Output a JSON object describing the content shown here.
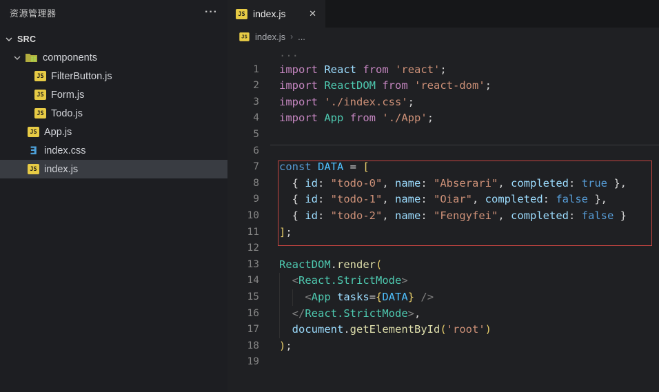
{
  "colors": {
    "accent_red_box": "#c64540",
    "js_icon_yellow": "#e7cb45",
    "css_icon_blue": "#4da0d8",
    "keyword": "#C586C0",
    "string": "#CE9178",
    "type": "#4EC9B0",
    "constant": "#4FC1FF"
  },
  "explorer": {
    "title": "资源管理器",
    "more_actions": "···",
    "section": "SRC",
    "tree": [
      {
        "label": "components",
        "icon": "folder",
        "indent": "folder-root",
        "expanded": true,
        "selected": false
      },
      {
        "label": "FilterButton.js",
        "icon": "js",
        "indent": "child",
        "expanded": null,
        "selected": false
      },
      {
        "label": "Form.js",
        "icon": "js",
        "indent": "child",
        "expanded": null,
        "selected": false
      },
      {
        "label": "Todo.js",
        "icon": "js",
        "indent": "child",
        "expanded": null,
        "selected": false
      },
      {
        "label": "App.js",
        "icon": "js",
        "indent": "root",
        "expanded": null,
        "selected": false
      },
      {
        "label": "index.css",
        "icon": "css",
        "indent": "root",
        "expanded": null,
        "selected": false
      },
      {
        "label": "index.js",
        "icon": "js",
        "indent": "root",
        "expanded": null,
        "selected": true
      }
    ]
  },
  "tab": {
    "label": "index.js",
    "close_glyph": "✕"
  },
  "breadcrumb": {
    "file": "index.js",
    "separator": "›",
    "tail": "..."
  },
  "editor": {
    "fold_hint": "...",
    "css_glyph": "Ǝ",
    "js_glyph": "JS",
    "lines": [
      {
        "num": 1,
        "guides": [],
        "tokens": [
          [
            "import",
            "kw"
          ],
          [
            " ",
            "pl"
          ],
          [
            "React",
            "var"
          ],
          [
            " ",
            "pl"
          ],
          [
            "from",
            "kw"
          ],
          [
            " ",
            "pl"
          ],
          [
            "'react'",
            "str"
          ],
          [
            ";",
            "pl"
          ]
        ]
      },
      {
        "num": 2,
        "guides": [],
        "tokens": [
          [
            "import",
            "kw"
          ],
          [
            " ",
            "pl"
          ],
          [
            "ReactDOM",
            "type"
          ],
          [
            " ",
            "pl"
          ],
          [
            "from",
            "kw"
          ],
          [
            " ",
            "pl"
          ],
          [
            "'react-dom'",
            "str"
          ],
          [
            ";",
            "pl"
          ]
        ]
      },
      {
        "num": 3,
        "guides": [],
        "tokens": [
          [
            "import",
            "kw"
          ],
          [
            " ",
            "pl"
          ],
          [
            "'./index.css'",
            "str"
          ],
          [
            ";",
            "pl"
          ]
        ]
      },
      {
        "num": 4,
        "guides": [],
        "tokens": [
          [
            "import",
            "kw"
          ],
          [
            " ",
            "pl"
          ],
          [
            "App",
            "type"
          ],
          [
            " ",
            "pl"
          ],
          [
            "from",
            "kw"
          ],
          [
            " ",
            "pl"
          ],
          [
            "'./App'",
            "str"
          ],
          [
            ";",
            "pl"
          ]
        ]
      },
      {
        "num": 5,
        "guides": [],
        "tokens": []
      },
      {
        "num": 6,
        "guides": [],
        "tokens": []
      },
      {
        "num": 7,
        "guides": [],
        "tokens": [
          [
            "const",
            "blue"
          ],
          [
            " ",
            "pl"
          ],
          [
            "DATA",
            "cvar"
          ],
          [
            " = ",
            "pl"
          ],
          [
            "[",
            "b1"
          ]
        ]
      },
      {
        "num": 8,
        "guides": [],
        "tokens": [
          [
            "  { ",
            "pl"
          ],
          [
            "id",
            "var"
          ],
          [
            ": ",
            "pl"
          ],
          [
            "\"todo-0\"",
            "str"
          ],
          [
            ", ",
            "pl"
          ],
          [
            "name",
            "var"
          ],
          [
            ": ",
            "pl"
          ],
          [
            "\"Abserari\"",
            "str"
          ],
          [
            ", ",
            "pl"
          ],
          [
            "completed",
            "var"
          ],
          [
            ": ",
            "pl"
          ],
          [
            "true",
            "blue"
          ],
          [
            " },",
            "pl"
          ]
        ]
      },
      {
        "num": 9,
        "guides": [],
        "tokens": [
          [
            "  { ",
            "pl"
          ],
          [
            "id",
            "var"
          ],
          [
            ": ",
            "pl"
          ],
          [
            "\"todo-1\"",
            "str"
          ],
          [
            ", ",
            "pl"
          ],
          [
            "name",
            "var"
          ],
          [
            ": ",
            "pl"
          ],
          [
            "\"Oiar\"",
            "str"
          ],
          [
            ", ",
            "pl"
          ],
          [
            "completed",
            "var"
          ],
          [
            ": ",
            "pl"
          ],
          [
            "false",
            "blue"
          ],
          [
            " },",
            "pl"
          ]
        ]
      },
      {
        "num": 10,
        "guides": [],
        "tokens": [
          [
            "  { ",
            "pl"
          ],
          [
            "id",
            "var"
          ],
          [
            ": ",
            "pl"
          ],
          [
            "\"todo-2\"",
            "str"
          ],
          [
            ", ",
            "pl"
          ],
          [
            "name",
            "var"
          ],
          [
            ": ",
            "pl"
          ],
          [
            "\"Fengyfei\"",
            "str"
          ],
          [
            ", ",
            "pl"
          ],
          [
            "completed",
            "var"
          ],
          [
            ": ",
            "pl"
          ],
          [
            "false",
            "blue"
          ],
          [
            " }",
            "pl"
          ]
        ]
      },
      {
        "num": 11,
        "guides": [],
        "tokens": [
          [
            "]",
            "b1"
          ],
          [
            ";",
            "pl"
          ]
        ]
      },
      {
        "num": 12,
        "guides": [],
        "tokens": []
      },
      {
        "num": 13,
        "guides": [],
        "tokens": [
          [
            "ReactDOM",
            "type"
          ],
          [
            ".",
            "pl"
          ],
          [
            "render",
            "fn"
          ],
          [
            "(",
            "b1"
          ]
        ]
      },
      {
        "num": 14,
        "guides": [
          0
        ],
        "tokens": [
          [
            "  ",
            "pl"
          ],
          [
            "<",
            "tag"
          ],
          [
            "React.StrictMode",
            "type"
          ],
          [
            ">",
            "tag"
          ]
        ]
      },
      {
        "num": 15,
        "guides": [
          0,
          2
        ],
        "tokens": [
          [
            "    ",
            "pl"
          ],
          [
            "<",
            "tag"
          ],
          [
            "App",
            "type"
          ],
          [
            " ",
            "pl"
          ],
          [
            "tasks",
            "var"
          ],
          [
            "=",
            "pl"
          ],
          [
            "{",
            "b1"
          ],
          [
            "DATA",
            "cvar"
          ],
          [
            "}",
            "b1"
          ],
          [
            " ",
            "pl"
          ],
          [
            "/>",
            "tag"
          ]
        ]
      },
      {
        "num": 16,
        "guides": [
          0
        ],
        "tokens": [
          [
            "  ",
            "pl"
          ],
          [
            "</",
            "tag"
          ],
          [
            "React.StrictMode",
            "type"
          ],
          [
            ">",
            "tag"
          ],
          [
            ",",
            "pl"
          ]
        ]
      },
      {
        "num": 17,
        "guides": [
          0
        ],
        "tokens": [
          [
            "  ",
            "pl"
          ],
          [
            "document",
            "var"
          ],
          [
            ".",
            "pl"
          ],
          [
            "getElementById",
            "fn"
          ],
          [
            "(",
            "b1"
          ],
          [
            "'root'",
            "str"
          ],
          [
            ")",
            "b1"
          ]
        ]
      },
      {
        "num": 18,
        "guides": [],
        "tokens": [
          [
            ")",
            "b1"
          ],
          [
            ";",
            "pl"
          ]
        ]
      },
      {
        "num": 19,
        "guides": [],
        "tokens": []
      }
    ]
  }
}
